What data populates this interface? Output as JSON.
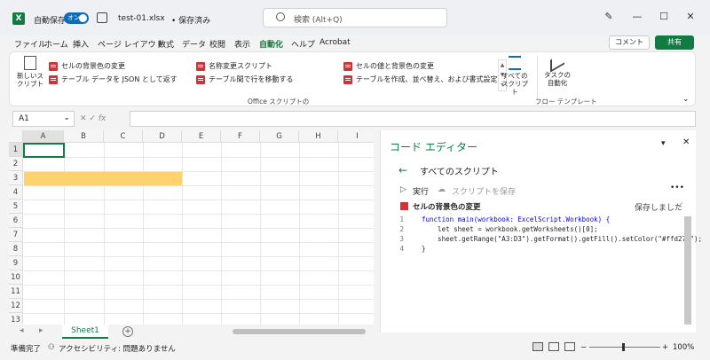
{
  "titlebar": {
    "app_icon": "X",
    "autosave_label": "自動保存",
    "toggle_label": "オン",
    "filename": "test-01.xlsx",
    "save_state": "• 保存済み",
    "search_placeholder": "検索 (Alt+Q)",
    "minimize": "—",
    "maximize": "☐",
    "close": "✕",
    "pen_icon": "✎"
  },
  "menu": {
    "items": [
      "ファイル",
      "ホーム",
      "挿入",
      "ページ レイアウト",
      "数式",
      "データ",
      "校閲",
      "表示",
      "自動化",
      "ヘルプ",
      "Acrobat"
    ],
    "active": "自動化",
    "comment": "コメント",
    "share": "共有"
  },
  "ribbon": {
    "new_script": "新しいスクリプト",
    "scripts": [
      "セルの背景色の変更",
      "テーブル データを JSON として返す",
      "名称変更スクリプト",
      "テーブル間で行を移動する",
      "セルの値と背景色の変更",
      "テーブルを作成、並べ替え、および書式設定"
    ],
    "all_scripts": "すべてのスクリプト",
    "group_office": "Office スクリプトの",
    "task_automation": "タスクの自動化",
    "group_flow": "フロー テンプレート"
  },
  "formula": {
    "namebox": "A1",
    "fx": "fx"
  },
  "grid": {
    "columns": [
      "A",
      "B",
      "C",
      "D",
      "E",
      "F",
      "G",
      "H",
      "I"
    ],
    "rows": [
      "1",
      "2",
      "3",
      "4",
      "5",
      "6",
      "7",
      "8",
      "9",
      "10",
      "11",
      "12",
      "13"
    ],
    "fill_color": "#ffd270"
  },
  "sheets": {
    "tab": "Sheet1",
    "add": "+"
  },
  "editor": {
    "title": "コード エディター",
    "back_label": "すべてのスクリプト",
    "run": "実行",
    "save": "スクリプトを保存",
    "more": "•••",
    "script_name": "セルの背景色の変更",
    "saved": "保存しました",
    "code": [
      [
        "1",
        "function main(workbook: ExcelScript.Workbook) {"
      ],
      [
        "2",
        "    let sheet = workbook.getWorksheets()[0];"
      ],
      [
        "3",
        "    sheet.getRange(\"A3:D3\").getFormat().getFill().setColor(\"#ffd270\");"
      ],
      [
        "4",
        "}"
      ]
    ]
  },
  "status": {
    "ready": "準備完了",
    "accessibility": "アクセシビリティ: 問題ありません",
    "zoom": "100%"
  }
}
